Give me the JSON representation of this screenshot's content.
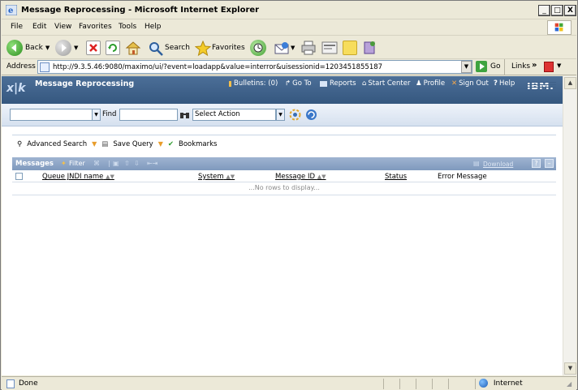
{
  "window": {
    "title": "Message Reprocessing - Microsoft Internet Explorer",
    "min_symbol": "_",
    "max_symbol": "□",
    "close_symbol": "X"
  },
  "menu": [
    "File",
    "Edit",
    "View",
    "Favorites",
    "Tools",
    "Help"
  ],
  "toolbar": {
    "back_label": "Back",
    "search_label": "Search",
    "favorites_label": "Favorites"
  },
  "address": {
    "label": "Address",
    "url": "http://9.3.5.46:9080/maximo/ui/?event=loadapp&value=interror&uisessionid=1203451855187",
    "go_label": "Go",
    "links_label": "Links",
    "links_chevron": "»"
  },
  "maximo": {
    "logo": "x|k",
    "app_title": "Message Reprocessing",
    "nav": {
      "bulletins": "Bulletins: (0)",
      "goto": "Go To",
      "reports": "Reports",
      "start_center": "Start Center",
      "profile": "Profile",
      "sign_out": "Sign Out",
      "help": "Help"
    },
    "brand": "IBM.",
    "find_label": "Find",
    "select_action": "Select Action"
  },
  "query_bar": {
    "advanced_search": "Advanced Search",
    "save_query": "Save Query",
    "bookmarks": "Bookmarks"
  },
  "table": {
    "title": "Messages",
    "filter_label": "Filter",
    "download_label": "Download",
    "help_symbol": "?",
    "columns": [
      "Queue JNDI name",
      "System",
      "Message ID",
      "Status",
      "Error Message"
    ],
    "empty_text": "...No rows to display..."
  },
  "status_bar": {
    "status_text": "Done",
    "zone": "Internet"
  },
  "colors": {
    "xp_chrome": "#ece9d8",
    "maximo_header": "#3f6189",
    "table_header": "#8ca4c6"
  }
}
